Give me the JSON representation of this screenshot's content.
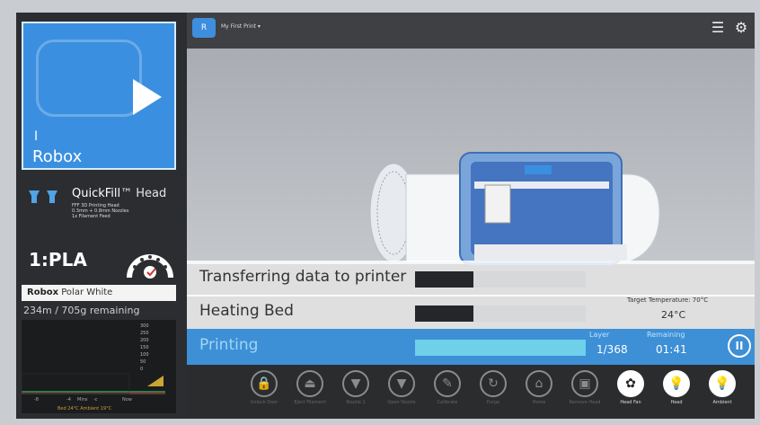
{
  "left": {
    "printer": {
      "cursor": "I",
      "name": "Robox"
    },
    "head": {
      "brand": "QuickFill",
      "tm": "™",
      "suffix": "Head",
      "line1": "FFF 3D Printing Head",
      "line2": "0.3mm + 0.8mm Nozzles",
      "line3": "1x Filament Feed"
    },
    "filament": {
      "title": "1:PLA",
      "brand": "Robox",
      "color_name": "Polar White",
      "remaining": "234m / 705g remaining"
    },
    "graph": {
      "ticks": [
        "300",
        "250",
        "200",
        "150",
        "100",
        "50",
        "0"
      ],
      "x_labels": [
        "-8",
        "-4",
        "Mins",
        "-c",
        "Now"
      ],
      "status": "Bed 24°C    Ambient 19°C"
    }
  },
  "header": {
    "project_name": "My First Print",
    "project_caret": "▾",
    "icons": [
      "printer-status-icon",
      "gear-icon"
    ]
  },
  "status": {
    "transfer_label": "Transferring data to printer",
    "transfer_progress": 0.34,
    "bed_label": "Heating Bed",
    "bed_progress": 0.34,
    "target_temperature": "Target Temperature: 70°C",
    "bed_temperature": "24°C",
    "print_label": "Printing",
    "print_progress": 1.0,
    "layer_label": "Layer",
    "layer_value": "1/368",
    "remaining_label": "Remaining",
    "remaining_value": "01:41",
    "pause_glyph": "II"
  },
  "toolbar": [
    {
      "label": "Unlock Door",
      "glyph": "🔒",
      "icon": "lock-icon",
      "active": false
    },
    {
      "label": "Eject Filament",
      "glyph": "⏏",
      "icon": "eject-icon",
      "active": false
    },
    {
      "label": "Nozzle 1",
      "glyph": "▼",
      "icon": "nozzle-icon",
      "active": false
    },
    {
      "label": "Open Nozzle",
      "glyph": "▼",
      "icon": "open-nozzle-icon",
      "active": false
    },
    {
      "label": "Calibrate",
      "glyph": "✎",
      "icon": "calibrate-icon",
      "active": false
    },
    {
      "label": "Purge",
      "glyph": "↻",
      "icon": "purge-icon",
      "active": false
    },
    {
      "label": "Home",
      "glyph": "⌂",
      "icon": "home-icon",
      "active": false
    },
    {
      "label": "Remove Head",
      "glyph": "▣",
      "icon": "remove-head-icon",
      "active": false
    },
    {
      "label": "Head Fan",
      "glyph": "✿",
      "icon": "fan-icon",
      "active": true
    },
    {
      "label": "Head",
      "glyph": "💡",
      "icon": "head-light-icon",
      "active": true
    },
    {
      "label": "Ambient",
      "glyph": "💡",
      "icon": "ambient-light-icon",
      "active": true
    }
  ],
  "colors": {
    "accent": "#3b8fe0",
    "status_bar": "#3d8fd6",
    "progress_fill": "#6fd0ea"
  }
}
